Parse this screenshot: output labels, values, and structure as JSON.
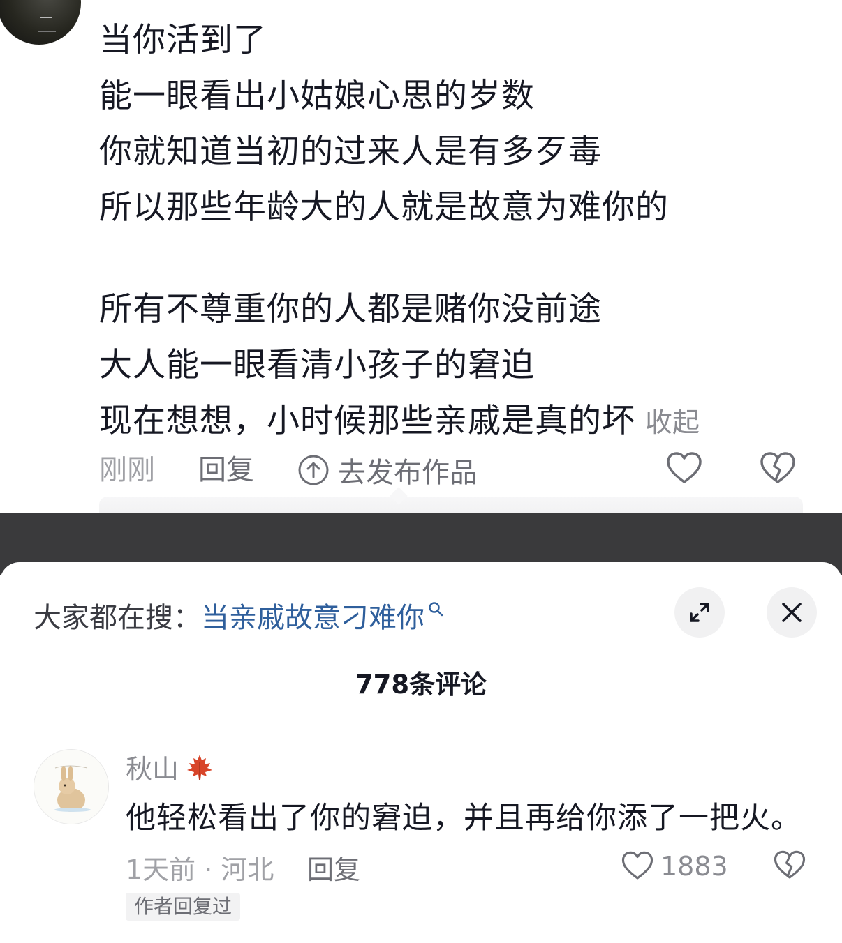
{
  "top_comment": {
    "lines": [
      "当你活到了",
      "能一眼看出小姑娘心思的岁数",
      "你就知道当初的过来人是有多歹毒",
      "所以那些年龄大的人就是故意为难你的",
      "所有不尊重你的人都是赌你没前途",
      "大人能一眼看清小孩子的窘迫",
      "现在想想，小时候那些亲戚是真的坏"
    ],
    "collapse_label": "收起",
    "time": "刚刚",
    "reply_label": "回复",
    "publish_label": "去发布作品"
  },
  "sheet": {
    "search_prefix": "大家都在搜：",
    "search_term": "当亲戚故意刁难你",
    "comment_count": "778条评论"
  },
  "comment": {
    "username": "秋山",
    "text": "他轻松看出了你的窘迫，并且再给你添了一把火。",
    "time_location": "1天前 · 河北",
    "reply_label": "回复",
    "likes": "1883",
    "author_badge": "作者回复过"
  },
  "colors": {
    "text_primary": "#161823",
    "text_secondary": "#a0a1a6",
    "link_blue": "#2f5f9c",
    "band_dark": "#3a3a3c",
    "maple_red": "#d8452a"
  },
  "icons": [
    "upload-icon",
    "heart-icon",
    "broken-heart-icon",
    "search-icon",
    "expand-icon",
    "close-icon",
    "maple-leaf-icon",
    "avatar"
  ]
}
